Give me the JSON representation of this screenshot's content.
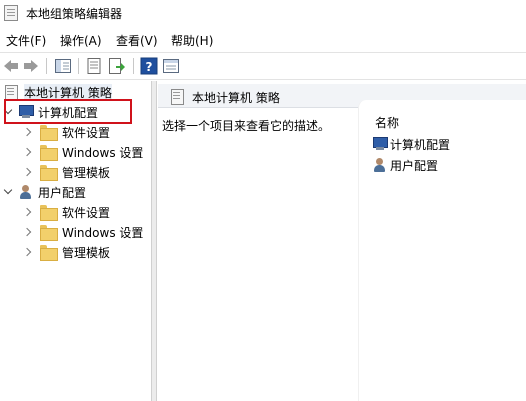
{
  "window": {
    "title": "本地组策略编辑器"
  },
  "menu": {
    "items": [
      {
        "label": "文件(F)"
      },
      {
        "label": "操作(A)"
      },
      {
        "label": "查看(V)"
      },
      {
        "label": "帮助(H)"
      }
    ]
  },
  "toolbar": {
    "buttons": [
      {
        "icon": "back-arrow-icon"
      },
      {
        "icon": "forward-arrow-icon"
      },
      {
        "icon": "show-hide-tree-icon"
      },
      {
        "icon": "properties-icon"
      },
      {
        "icon": "export-list-icon"
      },
      {
        "icon": "help-icon"
      },
      {
        "icon": "view-icon"
      }
    ]
  },
  "tree": {
    "root": {
      "label": "本地计算机 策略"
    },
    "computer_config": {
      "label": "计算机配置",
      "children": [
        {
          "label": "软件设置"
        },
        {
          "label": "Windows 设置"
        },
        {
          "label": "管理模板"
        }
      ]
    },
    "user_config": {
      "label": "用户配置",
      "children": [
        {
          "label": "软件设置"
        },
        {
          "label": "Windows 设置"
        },
        {
          "label": "管理模板"
        }
      ]
    }
  },
  "details": {
    "header": "本地计算机 策略",
    "description": "选择一个项目来查看它的描述。",
    "column_name": "名称",
    "items": [
      {
        "label": "计算机配置",
        "icon": "computer-icon"
      },
      {
        "label": "用户配置",
        "icon": "user-icon"
      }
    ]
  },
  "colors": {
    "highlight_border": "#d0121b",
    "folder": "#f2d06b"
  }
}
